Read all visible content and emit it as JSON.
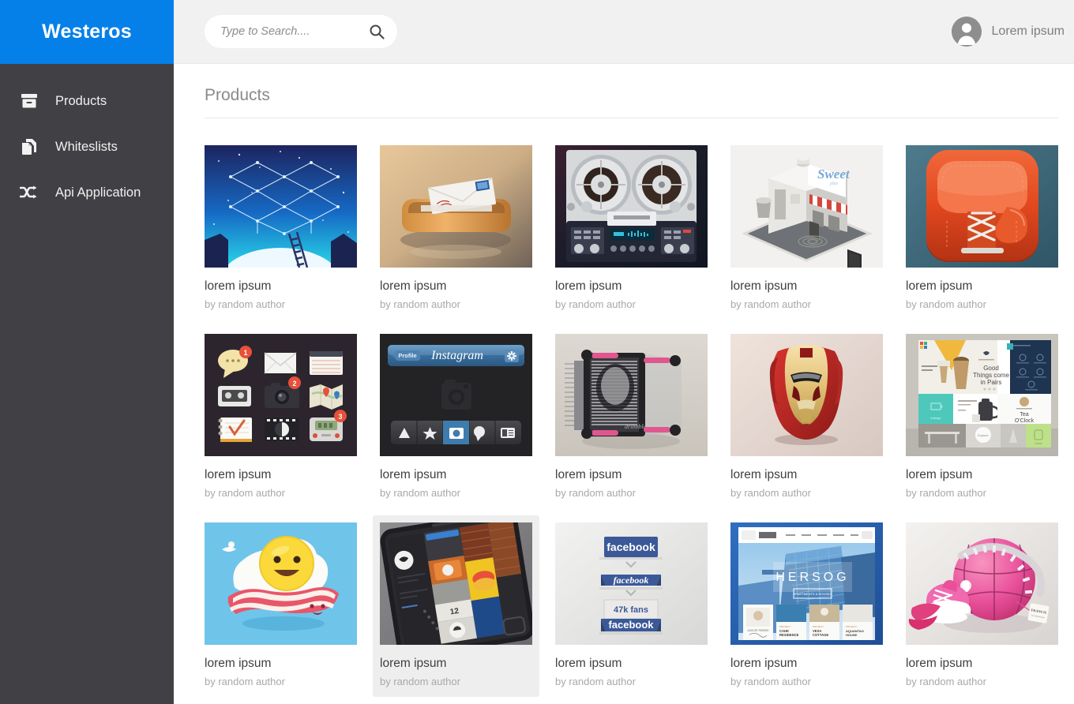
{
  "brand": {
    "title": "Westeros",
    "color": "#0580e8"
  },
  "sidebar": {
    "background": "#414145",
    "items": [
      {
        "label": "Products",
        "icon": "archive-box-icon"
      },
      {
        "label": "Whiteslists",
        "icon": "documents-icon"
      },
      {
        "label": "Api Application",
        "icon": "shuffle-icon"
      }
    ]
  },
  "topbar": {
    "search": {
      "placeholder": "Type to Search....",
      "value": "",
      "icon": "search-icon"
    },
    "user": {
      "name": "Lorem ipsum",
      "avatar": "user-avatar-icon"
    }
  },
  "page": {
    "title": "Products"
  },
  "products": [
    {
      "title": "lorem ipsum",
      "author": "by random author",
      "thumb": "dropbox-constellation-night-sky",
      "hovered": false
    },
    {
      "title": "lorem ipsum",
      "author": "by random author",
      "thumb": "wooden-inbox-tray-envelope",
      "hovered": false
    },
    {
      "title": "lorem ipsum",
      "author": "by random author",
      "thumb": "reel-to-reel-tape-recorder",
      "hovered": false
    },
    {
      "title": "lorem ipsum",
      "author": "by random author",
      "thumb": "isometric-sweet-shop",
      "hovered": false
    },
    {
      "title": "lorem ipsum",
      "author": "by random author",
      "thumb": "orange-leather-boxing-glove",
      "hovered": false
    },
    {
      "title": "lorem ipsum",
      "author": "by random author",
      "thumb": "app-icon-grid-badges",
      "hovered": false
    },
    {
      "title": "lorem ipsum",
      "author": "by random author",
      "thumb": "instagram-ui-mockup",
      "hovered": false
    },
    {
      "title": "lorem ipsum",
      "author": "by random author",
      "thumb": "pin-art-dribbble-toy",
      "hovered": false
    },
    {
      "title": "lorem ipsum",
      "author": "by random author",
      "thumb": "iron-man-helmet",
      "hovered": false
    },
    {
      "title": "lorem ipsum",
      "author": "by random author",
      "thumb": "web-design-tiles-mockup",
      "hovered": false
    },
    {
      "title": "lorem ipsum",
      "author": "by random author",
      "thumb": "smiling-egg-on-bacon",
      "hovered": false
    },
    {
      "title": "lorem ipsum",
      "author": "by random author",
      "thumb": "phone-tile-interface",
      "hovered": true
    },
    {
      "title": "lorem ipsum",
      "author": "by random author",
      "thumb": "facebook-likebox-widget",
      "hovered": false
    },
    {
      "title": "lorem ipsum",
      "author": "by random author",
      "thumb": "hersog-architecture-site",
      "hovered": false
    },
    {
      "title": "lorem ipsum",
      "author": "by random author",
      "thumb": "pink-zipper-basketball-sneakers",
      "hovered": false
    }
  ],
  "thumb_text": {
    "instagram_brand": "Instagram",
    "instagram_profile": "Profile",
    "facebook_word": "facebook",
    "facebook_fans": "47k fans",
    "hersog_word": "HERSOG",
    "sweet_word": "Sweet",
    "tiles_headline": "Good Things come in Pairs",
    "tiles_tea": "Tea O'Clock",
    "badges": [
      "1",
      "2",
      "3"
    ]
  }
}
